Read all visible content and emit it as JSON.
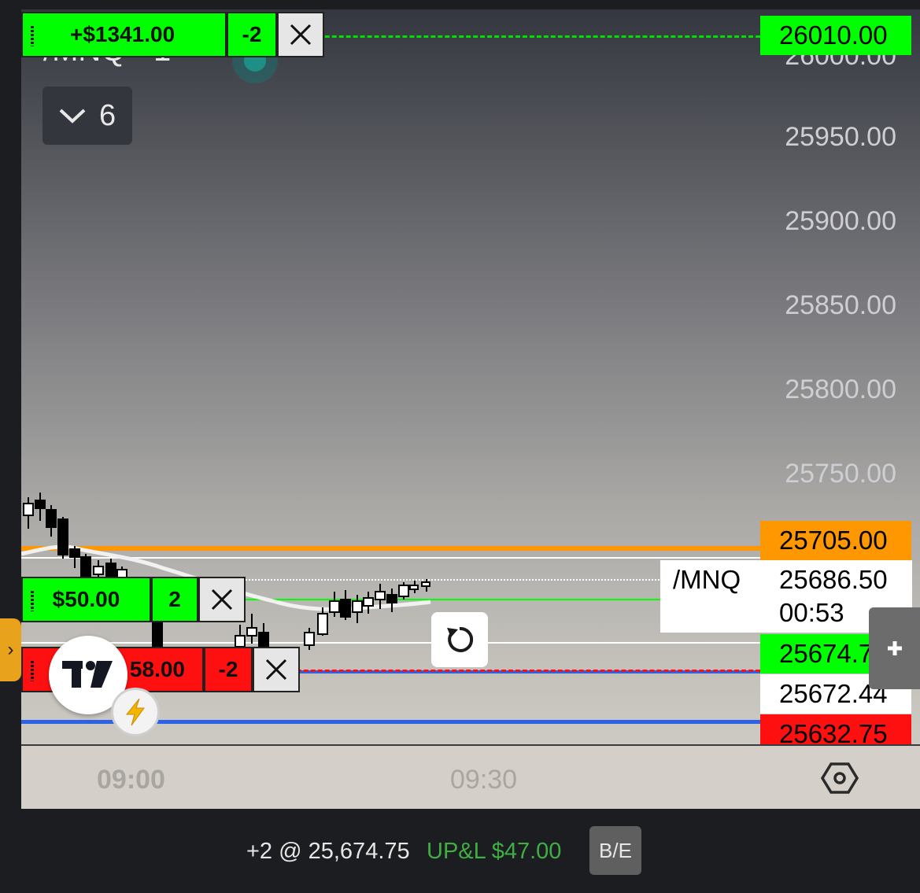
{
  "symbol": {
    "title": "/MNQ · 1",
    "interval_dropdown": "6"
  },
  "price_axis": {
    "labels": [
      "26000.00",
      "25950.00",
      "25900.00",
      "25850.00",
      "25800.00",
      "25750.00"
    ]
  },
  "time_axis": {
    "labels": [
      "09:00",
      "09:30"
    ]
  },
  "price_tags": {
    "take_profit": "26010.00",
    "orange_level": "25705.00",
    "last_symbol": "/MNQ",
    "last_price": "25686.50",
    "countdown": "00:53",
    "position_price": "25674.75",
    "position_price_visible": "25674.7",
    "average_price": "25672.44",
    "stop_level": "25632.75"
  },
  "orders": {
    "top": {
      "pnl": "+$1341.00",
      "qty": "-2",
      "close_icon": "close-icon"
    },
    "position": {
      "pnl": "$50.00",
      "qty": "2",
      "close_icon": "close-icon"
    },
    "stop": {
      "pnl": "$58.00",
      "pnl_visible": "58.00",
      "qty": "-2",
      "close_icon": "close-icon"
    }
  },
  "bottom_bar": {
    "position_text": "+2 @ 25,674.75",
    "upl_text": "UP&L $47.00",
    "be_button": "B/E"
  },
  "colors": {
    "green": "#00ff00",
    "red": "#ff1010",
    "orange": "#ff9800",
    "blue": "#2b63e8",
    "profit_text": "#3fae43"
  },
  "icons": [
    "chevron-down-icon",
    "reset-icon",
    "settings-hexagon-icon",
    "plus-icon",
    "tradingview-logo",
    "lightning-icon",
    "chevron-right-icon"
  ]
}
